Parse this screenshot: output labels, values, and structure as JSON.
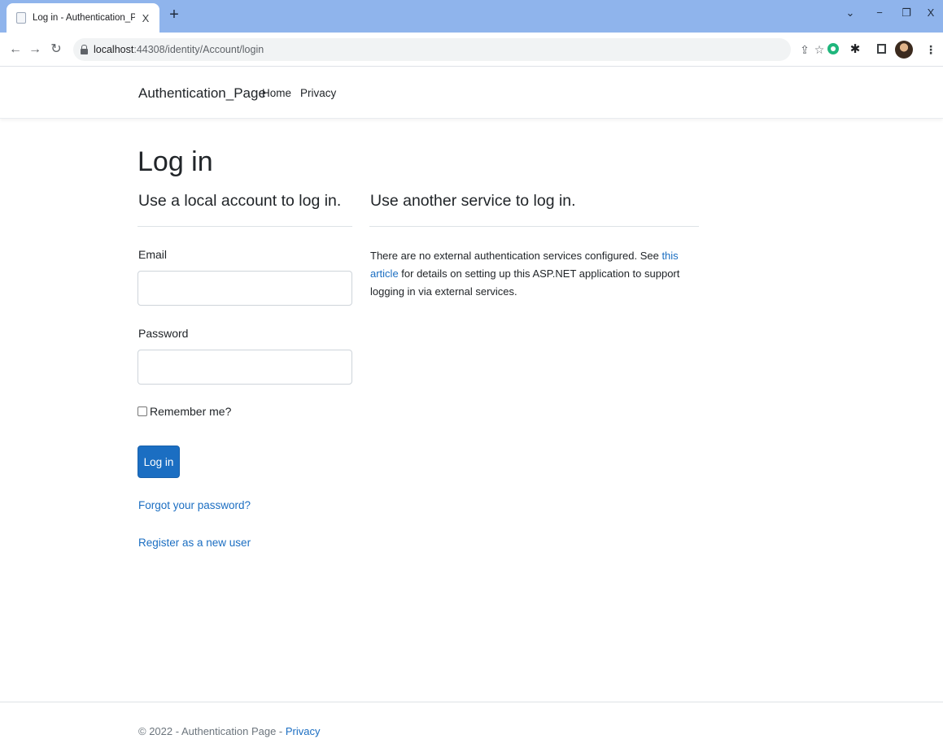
{
  "browser": {
    "tab_title": "Log in - Authentication_Page",
    "tab_close": "X",
    "new_tab": "+",
    "url_host": "localhost",
    "url_path": ":44308/identity/Account/login",
    "window_controls": {
      "dropdown": "⌄",
      "minimize": "−",
      "restore": "❐",
      "close": "X"
    },
    "toolbar_icons": [
      "share-icon",
      "star-icon",
      "extension-green-icon",
      "puzzle-icon",
      "sidepanel-icon",
      "profile-avatar",
      "more-icon"
    ]
  },
  "navbar": {
    "brand": "Authentication_Page",
    "links": [
      "Home",
      "Privacy"
    ]
  },
  "main": {
    "title": "Log in",
    "local_heading": "Use a local account to log in.",
    "email_label": "Email",
    "email_value": "",
    "password_label": "Password",
    "password_value": "",
    "remember_label": "Remember me?",
    "login_button": "Log in",
    "forgot_link": "Forgot your password?",
    "register_link": "Register as a new user",
    "external_heading": "Use another service to log in.",
    "external_text_before": "There are no external authentication services configured. See ",
    "external_link": "this article",
    "external_text_after": " for details on setting up this ASP.NET application to support logging in via external services."
  },
  "footer": {
    "copyright": "© 2022 - Authentication Page - ",
    "privacy_link": "Privacy"
  },
  "colors": {
    "accent": "#1b6ec2",
    "tabstrip": "#8fb4ec",
    "text": "#212529",
    "muted": "#6c757d"
  }
}
